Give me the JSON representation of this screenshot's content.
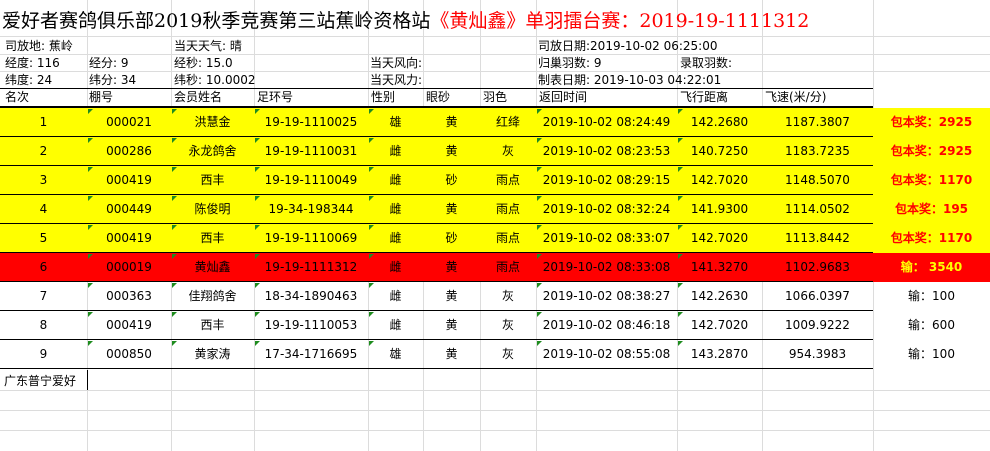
{
  "title": {
    "prefix": "爱好者赛鸽俱乐部2019秋季竞赛第三站蕉岭资格站",
    "highlight": "《黄灿鑫》单羽擂台赛：2019-19-1111312"
  },
  "info": {
    "release_place": "司放地: 蕉岭",
    "weather": "当天天气: 晴",
    "release_date": "司放日期:2019-10-02 06:25:00",
    "longitude_deg": "经度: 116",
    "longitude_min": "经分: 9",
    "longitude_sec": "经秒: 15.0",
    "wind_dir": "当天风向:",
    "returned": "归巢羽数: 9",
    "recorded": "录取羽数:",
    "latitude_deg": "纬度: 24",
    "latitude_min": "纬分: 34",
    "latitude_sec": "纬秒: 10.0002",
    "wind_force": "当天风力:",
    "table_date": "制表日期: 2019-10-03 04:22:01"
  },
  "headers": [
    "名次",
    "棚号",
    "会员姓名",
    "足环号",
    "性别",
    "眼砂",
    "羽色",
    "返回时间",
    "飞行距离",
    "飞速(米/分)"
  ],
  "rows": [
    {
      "rank": "1",
      "shed": "000021",
      "name": "洪慧金",
      "ring": "19-19-1110025",
      "sex": "雄",
      "eye": "黄",
      "color": "红绛",
      "time": "2019-10-02 08:24:49",
      "dist": "142.2680",
      "speed": "1187.3807",
      "prize": "包本奖：2925",
      "style": "yellow"
    },
    {
      "rank": "2",
      "shed": "000286",
      "name": "永龙鸽舍",
      "ring": "19-19-1110031",
      "sex": "雌",
      "eye": "黄",
      "color": "灰",
      "time": "2019-10-02 08:23:53",
      "dist": "140.7250",
      "speed": "1183.7235",
      "prize": "包本奖：2925",
      "style": "yellow"
    },
    {
      "rank": "3",
      "shed": "000419",
      "name": "西丰",
      "ring": "19-19-1110049",
      "sex": "雌",
      "eye": "砂",
      "color": "雨点",
      "time": "2019-10-02 08:29:15",
      "dist": "142.7020",
      "speed": "1148.5070",
      "prize": "包本奖：1170",
      "style": "yellow"
    },
    {
      "rank": "4",
      "shed": "000449",
      "name": "陈俊明",
      "ring": "19-34-198344",
      "sex": "雌",
      "eye": "黄",
      "color": "雨点",
      "time": "2019-10-02 08:32:24",
      "dist": "141.9300",
      "speed": "1114.0502",
      "prize": "包本奖：195",
      "style": "yellow"
    },
    {
      "rank": "5",
      "shed": "000419",
      "name": "西丰",
      "ring": "19-19-1110069",
      "sex": "雌",
      "eye": "砂",
      "color": "雨点",
      "time": "2019-10-02 08:33:07",
      "dist": "142.7020",
      "speed": "1113.8442",
      "prize": "包本奖：1170",
      "style": "yellow"
    },
    {
      "rank": "6",
      "shed": "000019",
      "name": "黄灿鑫",
      "ring": "19-19-1111312",
      "sex": "雌",
      "eye": "黄",
      "color": "雨点",
      "time": "2019-10-02 08:33:08",
      "dist": "141.3270",
      "speed": "1102.9683",
      "prize": "输： 3540",
      "style": "red"
    },
    {
      "rank": "7",
      "shed": "000363",
      "name": "佳翔鸽舍",
      "ring": "18-34-1890463",
      "sex": "雌",
      "eye": "黄",
      "color": "灰",
      "time": "2019-10-02 08:38:27",
      "dist": "142.2630",
      "speed": "1066.0397",
      "prize": "输：100",
      "style": "plain"
    },
    {
      "rank": "8",
      "shed": "000419",
      "name": "西丰",
      "ring": "19-19-1110053",
      "sex": "雌",
      "eye": "黄",
      "color": "灰",
      "time": "2019-10-02 08:46:18",
      "dist": "142.7020",
      "speed": "1009.9222",
      "prize": "输：600",
      "style": "plain"
    },
    {
      "rank": "9",
      "shed": "000850",
      "name": "黄家涛",
      "ring": "17-34-1716695",
      "sex": "雄",
      "eye": "黄",
      "color": "灰",
      "time": "2019-10-02 08:55:08",
      "dist": "143.2870",
      "speed": "954.3983",
      "prize": "输：100",
      "style": "plain"
    }
  ],
  "footer": "广东普宁爱好"
}
